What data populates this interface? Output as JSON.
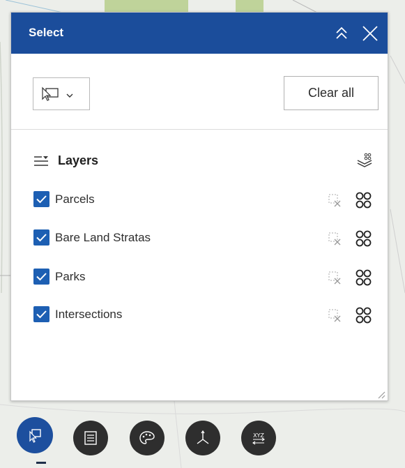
{
  "panel": {
    "title": "Select",
    "clear_all_label": "Clear all",
    "layers_heading": "Layers",
    "layers": [
      {
        "label": "Parcels",
        "checked": true
      },
      {
        "label": "Bare Land Stratas",
        "checked": true
      },
      {
        "label": "Parks",
        "checked": true
      },
      {
        "label": "Intersections",
        "checked": true
      }
    ],
    "icons": {
      "collapse": "chevrons-up-icon",
      "close": "close-icon",
      "select_tool": "rectangle-select-icon",
      "dropdown": "chevron-down-icon",
      "layers_list": "layer-list-icon",
      "select_all": "select-all-layers-icon",
      "clear_layer": "clear-selection-icon",
      "layer_select": "select-features-icon"
    }
  },
  "toolbar": {
    "buttons": [
      {
        "name": "select-tool-button",
        "icon": "select-icon",
        "active": true
      },
      {
        "name": "attribute-table-button",
        "icon": "table-icon",
        "active": false
      },
      {
        "name": "basemap-button",
        "icon": "palette-icon",
        "active": false
      },
      {
        "name": "coordinate-button",
        "icon": "axes-icon",
        "active": false
      },
      {
        "name": "xyz-button",
        "icon": "xyz-icon",
        "active": false
      }
    ]
  },
  "colors": {
    "header": "#1b4d9b",
    "checkbox": "#1d5fb3",
    "toolbar_button": "#2e2e2e",
    "toolbar_active": "#1d4f9e"
  }
}
